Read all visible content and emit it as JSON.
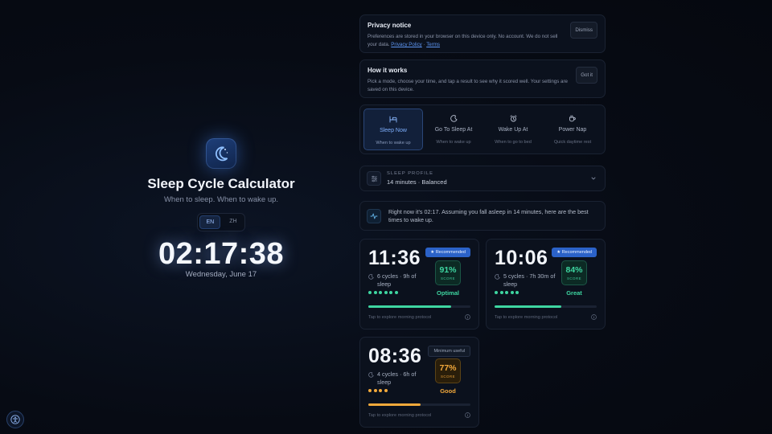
{
  "app": {
    "title": "Sleep Cycle Calculator",
    "subtitle": "When to sleep. When to wake up.",
    "languages": [
      "EN",
      "ZH"
    ],
    "active_language": "EN",
    "clock": "02:17:38",
    "date": "Wednesday, June 17"
  },
  "privacy": {
    "title": "Privacy notice",
    "text": "Preferences are stored in your browser on this device only. No account. We do not sell your data.",
    "privacy_link": "Privacy Policy",
    "separator": "·",
    "terms_link": "Terms",
    "dismiss": "Dismiss"
  },
  "how": {
    "title": "How it works",
    "text": "Pick a mode, choose your time, and tap a result to see why it scored well. Your settings are saved on this device.",
    "button": "Got it"
  },
  "modes": [
    {
      "label": "Sleep Now",
      "desc": "When to wake up",
      "icon": "bed-icon",
      "active": true
    },
    {
      "label": "Go To Sleep At",
      "desc": "When to wake up",
      "icon": "moon-icon",
      "active": false
    },
    {
      "label": "Wake Up At",
      "desc": "When to go to bed",
      "icon": "alarm-icon",
      "active": false
    },
    {
      "label": "Power Nap",
      "desc": "Quick daytime rest",
      "icon": "coffee-icon",
      "active": false
    }
  ],
  "profile": {
    "label": "SLEEP PROFILE",
    "value": "14 minutes · Balanced"
  },
  "info": {
    "text": "Right now it's 02:17. Assuming you fall asleep in 14 minutes, here are the best times to wake up."
  },
  "results": [
    {
      "time": "11:36",
      "cycles": "6 cycles · 9h of sleep",
      "badge": "★ Recommended",
      "score": "91%",
      "score_label": "SCORE",
      "quality": "Optimal",
      "dots": 6,
      "progress": 0.81,
      "footer": "Tap to explore morning protocol"
    },
    {
      "time": "10:06",
      "cycles": "5 cycles · 7h 30m of sleep",
      "badge": "★ Recommended",
      "score": "84%",
      "score_label": "SCORE",
      "quality": "Great",
      "dots": 5,
      "progress": 0.65,
      "footer": "Tap to explore morning protocol"
    },
    {
      "time": "08:36",
      "cycles": "4 cycles · 6h of sleep",
      "badge": "Minimum useful",
      "score": "77%",
      "score_label": "SCORE",
      "quality": "Good",
      "dots": 4,
      "progress": 0.51,
      "footer": "Tap to explore morning protocol"
    }
  ],
  "colors": {
    "accent": "#5d95f2",
    "green": "#3ed6a1",
    "amber": "#f3a93b"
  }
}
